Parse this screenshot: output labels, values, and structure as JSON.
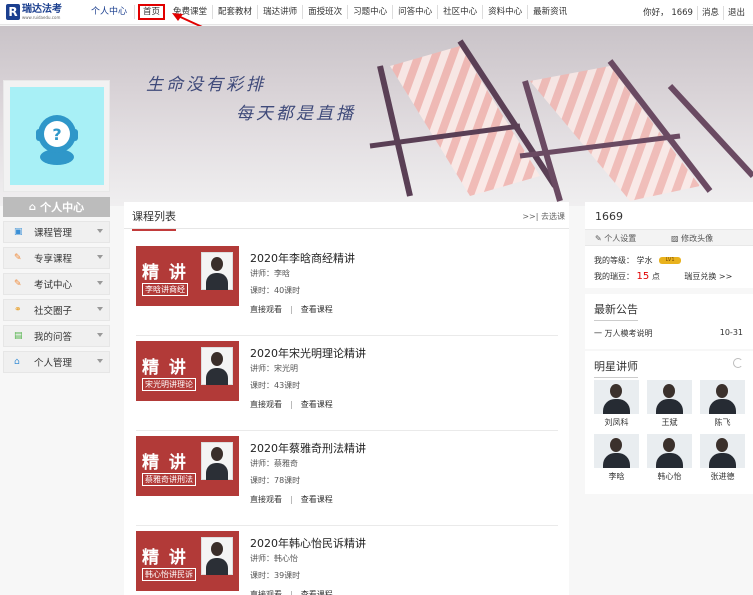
{
  "logo": {
    "mark": "R",
    "name": "瑞达法考",
    "url": "www.ruidaedu.com"
  },
  "nav": {
    "user_center": "个人中心",
    "items": [
      "首页",
      "免费课堂",
      "配套教材",
      "瑞达讲师",
      "面授班次",
      "习题中心",
      "问答中心",
      "社区中心",
      "资料中心",
      "最新资讯"
    ]
  },
  "user_nav": {
    "greeting": "你好， 1669",
    "messages": "消息",
    "logout": "退出"
  },
  "banner": {
    "line1": "生命没有彩排",
    "line2": "每天都是直播"
  },
  "sidebar": {
    "title": "个人中心",
    "items": [
      {
        "label": "课程管理",
        "icon": "▣"
      },
      {
        "label": "专享课程",
        "icon": "✎"
      },
      {
        "label": "考试中心",
        "icon": "✎"
      },
      {
        "label": "社交圈子",
        "icon": "⚭"
      },
      {
        "label": "我的问答",
        "icon": "▤"
      },
      {
        "label": "个人管理",
        "icon": "⌂"
      }
    ]
  },
  "courses": {
    "header": "课程列表",
    "more": ">>|  去选课",
    "watch_label": "直接观看",
    "view_label": "查看课程",
    "list": [
      {
        "title": "2020年李晗商经精讲",
        "thumb_big": "精 讲",
        "thumb_sub": "李晗讲商经",
        "teacher": "讲师：李晗",
        "hours": "课时：40课时"
      },
      {
        "title": "2020年宋光明理论精讲",
        "thumb_big": "精 讲",
        "thumb_sub": "宋光明讲理论",
        "teacher": "讲师：宋光明",
        "hours": "课时：43课时"
      },
      {
        "title": "2020年蔡雅奇刑法精讲",
        "thumb_big": "精 讲",
        "thumb_sub": "蔡雅奇讲刑法",
        "teacher": "讲师：蔡雅奇",
        "hours": "课时：78课时"
      },
      {
        "title": "2020年韩心怡民诉精讲",
        "thumb_big": "精 讲",
        "thumb_sub": "韩心怡讲民诉",
        "teacher": "讲师：韩心怡",
        "hours": "课时：39课时"
      }
    ]
  },
  "user_panel": {
    "name": "1669",
    "settings": "个人设置",
    "avatar_edit": "修改头像",
    "level_label": "我的等级：",
    "level_value": "学水",
    "badge": "LV1",
    "beans_label": "我的瑞豆：",
    "beans_value": "15",
    "beans_unit": "点",
    "beans_exchange": "瑞豆兑换 >>"
  },
  "notice": {
    "title": "最新公告",
    "item": "一 万人模考说明",
    "date": "10-31"
  },
  "teachers": {
    "title": "明星讲师",
    "list": [
      "刘凤科",
      "王斌",
      "陈飞",
      "李晗",
      "韩心怡",
      "张进德"
    ]
  }
}
